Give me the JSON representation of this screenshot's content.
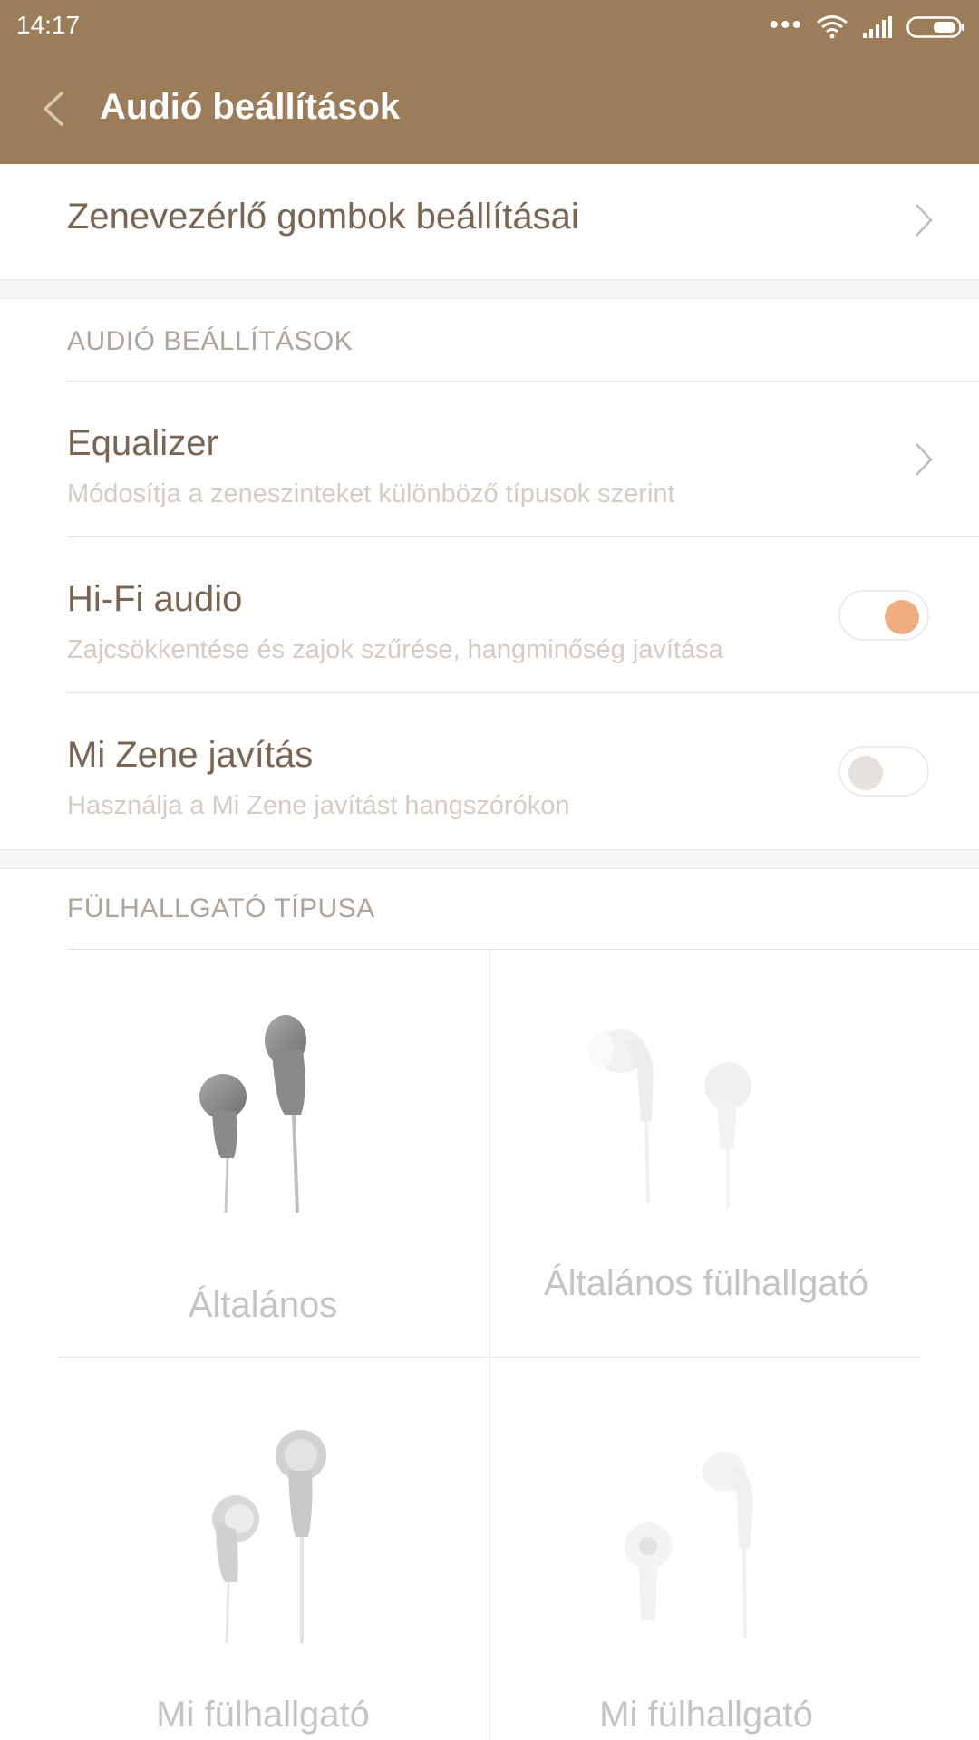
{
  "status_bar": {
    "time": "14:17"
  },
  "header": {
    "title": "Audió beállítások"
  },
  "music_controls_link": {
    "label": "Zenevezérlő gombok beállításai"
  },
  "audio_section": {
    "header": "AUDIÓ BEÁLLÍTÁSOK",
    "items": [
      {
        "title": "Equalizer",
        "subtitle": "Módosítja a zeneszinteket különböző típusok szerint",
        "control": "chevron"
      },
      {
        "title": "Hi-Fi audio",
        "subtitle": "Zajcsökkentése és zajok szűrése, hangminőség javítása",
        "control": "toggle",
        "toggle_on": true
      },
      {
        "title": "Mi Zene javítás",
        "subtitle": "Használja a Mi Zene javítást hangszórókon",
        "control": "toggle",
        "toggle_on": false
      }
    ]
  },
  "headphone_section": {
    "header": "FÜLHALLGATÓ TÍPUSA",
    "types": [
      {
        "name": "Általános",
        "icon": "earbuds-icon"
      },
      {
        "name": "Általános fülhallgató",
        "icon": "in-ear-headphones-icon"
      },
      {
        "name": "Mi fülhallgató",
        "icon": "mi-earbuds-icon"
      },
      {
        "name": "Mi fülhallgató",
        "icon": "mi-in-ear-headphones-icon"
      }
    ]
  },
  "colors": {
    "header_bg": "#9b7d5a",
    "primary_text": "#7a6452",
    "toggle_on": "#f0ad82"
  }
}
